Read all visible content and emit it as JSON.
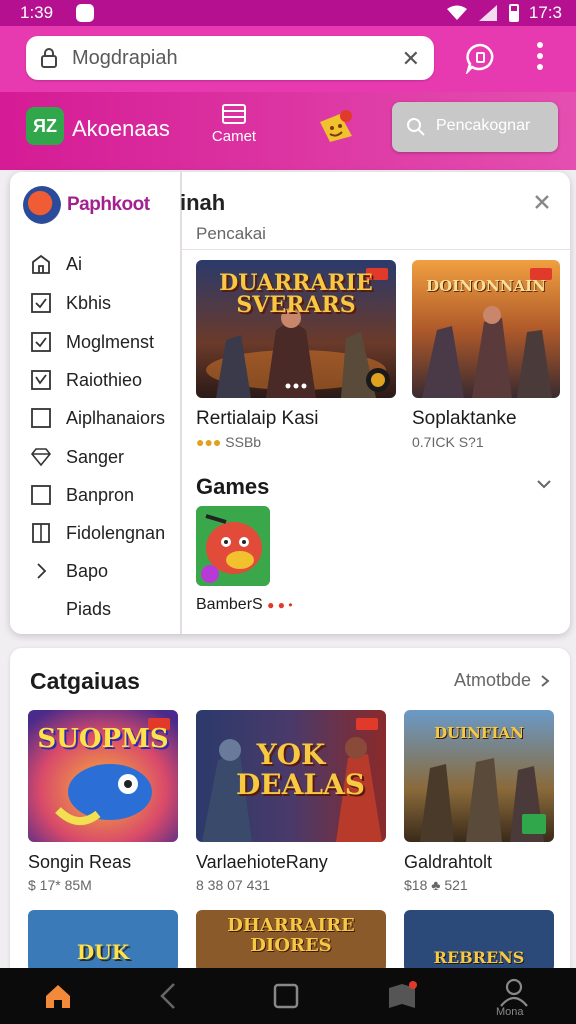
{
  "status": {
    "time": "1:39",
    "right_time": "17:3"
  },
  "urlbar": {
    "url": "Mogdrapiah"
  },
  "header": {
    "brand": "Akoenaas",
    "nav_label": "Camet",
    "search_button": "Pencakognar"
  },
  "panel": {
    "profile_name": "Paphkoot",
    "title": "inah",
    "subtitle": "Pencakai",
    "sidebar": [
      {
        "label": "Ai",
        "icon": "home-outline-icon"
      },
      {
        "label": "Kbhis",
        "icon": "checkbox-checked-icon"
      },
      {
        "label": "Moglmenst",
        "icon": "checkbox-checked-icon"
      },
      {
        "label": "Raiothieo",
        "icon": "checkbox-checked-icon"
      },
      {
        "label": "Aiplhanaiors",
        "icon": "checkbox-empty-icon"
      },
      {
        "label": "Sanger",
        "icon": "diamond-icon"
      },
      {
        "label": "Banpron",
        "icon": "checkbox-empty-icon"
      },
      {
        "label": "Fidolengnan",
        "icon": "book-icon"
      },
      {
        "label": "Bapo",
        "icon": "chevron-right-icon"
      },
      {
        "label": "Piads",
        "icon": ""
      }
    ],
    "featured": [
      {
        "art_title": "DUARRARIE SVERARS",
        "name": "Rertialaip Kasi",
        "meta": "SSBb"
      },
      {
        "art_title": "DOINONNAIN",
        "name": "Soplaktanke",
        "meta": "0.7ICK S?1"
      }
    ],
    "games_heading": "Games",
    "games": [
      {
        "name": "BamberS"
      }
    ]
  },
  "categories": {
    "heading": "Catgaiuas",
    "more": "Atmotbde",
    "items": [
      {
        "art_title": "SUOPMS",
        "name": "Songin Reas",
        "meta": "$ 17* 85M"
      },
      {
        "art_title": "YOK DEALAS",
        "name": "VarlaehioteRany",
        "meta": "8 38 07 431"
      },
      {
        "art_title": "DUINFIAN",
        "name": "Galdrahtolt",
        "meta": "$18 ♣ 521"
      }
    ],
    "row2": [
      {
        "art_title": "DUK"
      },
      {
        "art_title": "DHARRAIRE DIORES"
      },
      {
        "art_title": "REBRENS"
      }
    ]
  },
  "bottom_nav": {
    "profile_label": "Mona"
  },
  "colors": {
    "magenta": "#e83ab0",
    "brand_purple": "#a3208f",
    "status_bar": "#b5108f"
  }
}
